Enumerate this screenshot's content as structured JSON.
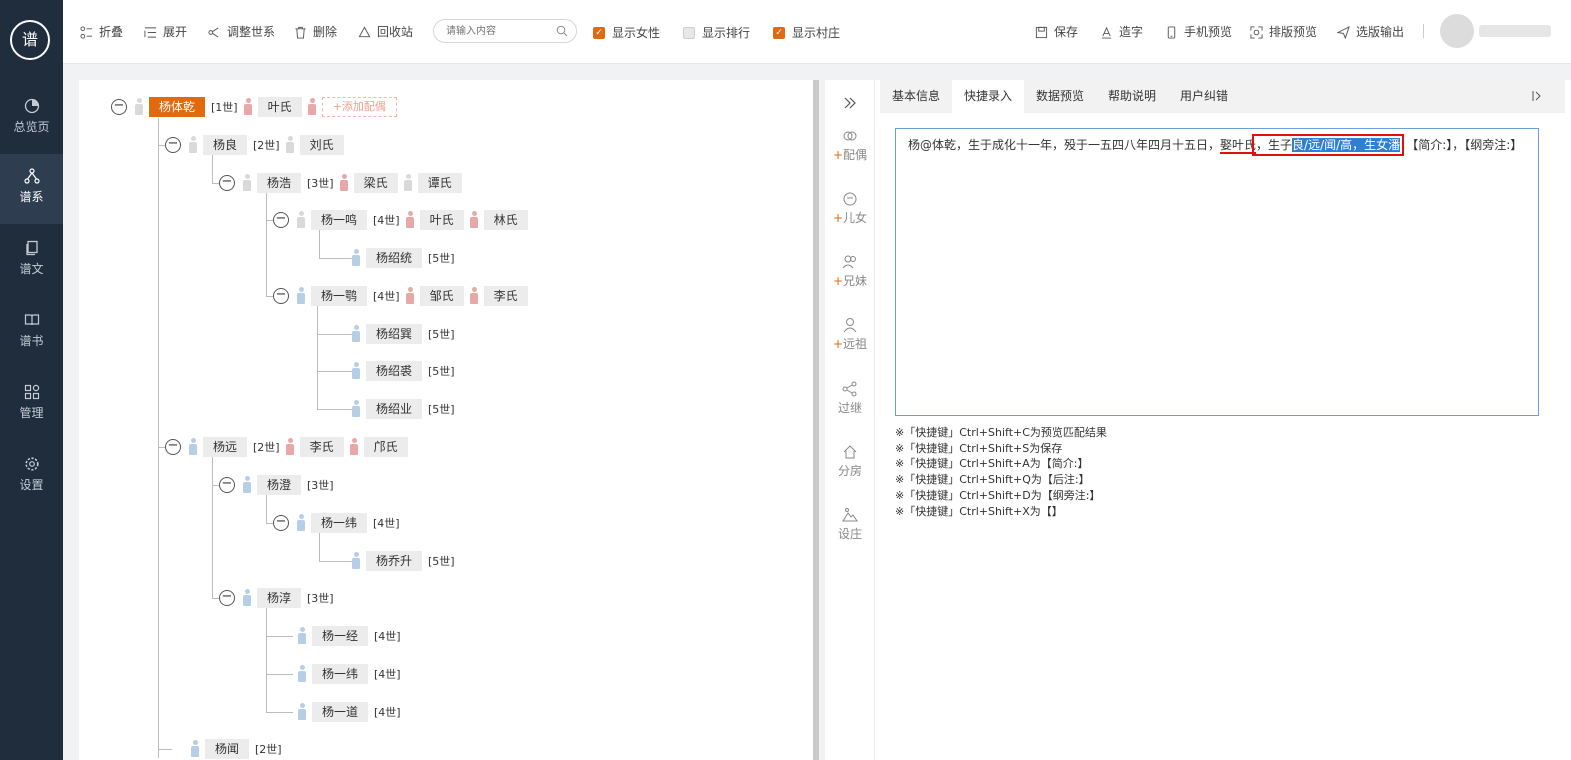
{
  "sidebar": {
    "logo": "谱",
    "items": [
      {
        "label": "总览页",
        "icon": "pie-chart-icon"
      },
      {
        "label": "谱系",
        "icon": "tree-icon",
        "active": true
      },
      {
        "label": "谱文",
        "icon": "document-icon"
      },
      {
        "label": "谱书",
        "icon": "book-icon"
      },
      {
        "label": "管理",
        "icon": "grid-icon"
      },
      {
        "label": "设置",
        "icon": "gear-icon"
      }
    ]
  },
  "toolbar": {
    "collapse": "折叠",
    "expand": "展开",
    "adjust": "调整世系",
    "delete": "删除",
    "recycle": "回收站",
    "search_placeholder": "请输入内容",
    "show_female": "显示女性",
    "show_rank": "显示排行",
    "show_village": "显示村庄",
    "save": "保存",
    "create_char": "造字",
    "mobile_preview": "手机预览",
    "layout_preview": "排版预览",
    "export": "选版输出"
  },
  "toggles": {
    "show_female": true,
    "show_rank": false,
    "show_village": true
  },
  "colors": {
    "accent": "#e06a0f",
    "sidebar": "#1f2d3d",
    "male": "#b7cfe6",
    "female": "#e9a8a8"
  },
  "tree": {
    "root": {
      "name": "杨体乾",
      "gen": "[1世]",
      "spouse": "叶氏",
      "add_spouse": "+添加配偶"
    },
    "n1": {
      "name": "杨良",
      "gen": "[2世]",
      "spouse": "刘氏"
    },
    "n2": {
      "name": "杨浩",
      "gen": "[3世]",
      "spouse1": "梁氏",
      "spouse2": "谭氏"
    },
    "n3": {
      "name": "杨一鸣",
      "gen": "[4世]",
      "spouse1": "叶氏",
      "spouse2": "林氏"
    },
    "n4": {
      "name": "杨绍统",
      "gen": "[5世]"
    },
    "n5": {
      "name": "杨一鹗",
      "gen": "[4世]",
      "spouse1": "邹氏",
      "spouse2": "李氏"
    },
    "n6": {
      "name": "杨绍巽",
      "gen": "[5世]"
    },
    "n7": {
      "name": "杨绍裘",
      "gen": "[5世]"
    },
    "n8": {
      "name": "杨绍业",
      "gen": "[5世]"
    },
    "n9": {
      "name": "杨远",
      "gen": "[2世]",
      "spouse1": "李氏",
      "spouse2": "邝氏"
    },
    "n10": {
      "name": "杨澄",
      "gen": "[3世]"
    },
    "n11": {
      "name": "杨一纬",
      "gen": "[4世]"
    },
    "n12": {
      "name": "杨乔升",
      "gen": "[5世]"
    },
    "n13": {
      "name": "杨淳",
      "gen": "[3世]"
    },
    "n14": {
      "name": "杨一经",
      "gen": "[4世]"
    },
    "n15": {
      "name": "杨一纬",
      "gen": "[4世]"
    },
    "n16": {
      "name": "杨一道",
      "gen": "[4世]"
    },
    "n17": {
      "name": "杨闻",
      "gen": "[2世]"
    }
  },
  "tools": [
    {
      "label": "配偶",
      "plus": "+",
      "icon": "spouse-icon"
    },
    {
      "label": "儿女",
      "plus": "+",
      "icon": "child-icon"
    },
    {
      "label": "兄妹",
      "plus": "+",
      "icon": "siblings-icon"
    },
    {
      "label": "远祖",
      "plus": "+",
      "icon": "ancestor-icon"
    },
    {
      "label": "过继",
      "plus": "",
      "icon": "share-icon"
    },
    {
      "label": "分房",
      "plus": "",
      "icon": "home-icon"
    },
    {
      "label": "设庄",
      "plus": "",
      "icon": "mountain-icon"
    }
  ],
  "tabs": [
    "基本信息",
    "快捷录入",
    "数据预览",
    "帮助说明",
    "用户纠错"
  ],
  "editor": {
    "text_before": "杨@体乾，生于成化十一年，殁于一五四八年四月十五日，",
    "underlined": "娶叶氏",
    "text_mid": "，生子",
    "selected": "良/远/闻/高，生女潘",
    "text_after": "，【简介:】，【纲旁注:】"
  },
  "hints": [
    "※「快捷键」Ctrl+Shift+C为预览匹配结果",
    "※「快捷键」Ctrl+Shift+S为保存",
    "※「快捷键」Ctrl+Shift+A为【简介:】",
    "※「快捷键」Ctrl+Shift+Q为【后注:】",
    "※「快捷键」Ctrl+Shift+D为【纲旁注:】",
    "※「快捷键」Ctrl+Shift+X为【】"
  ]
}
